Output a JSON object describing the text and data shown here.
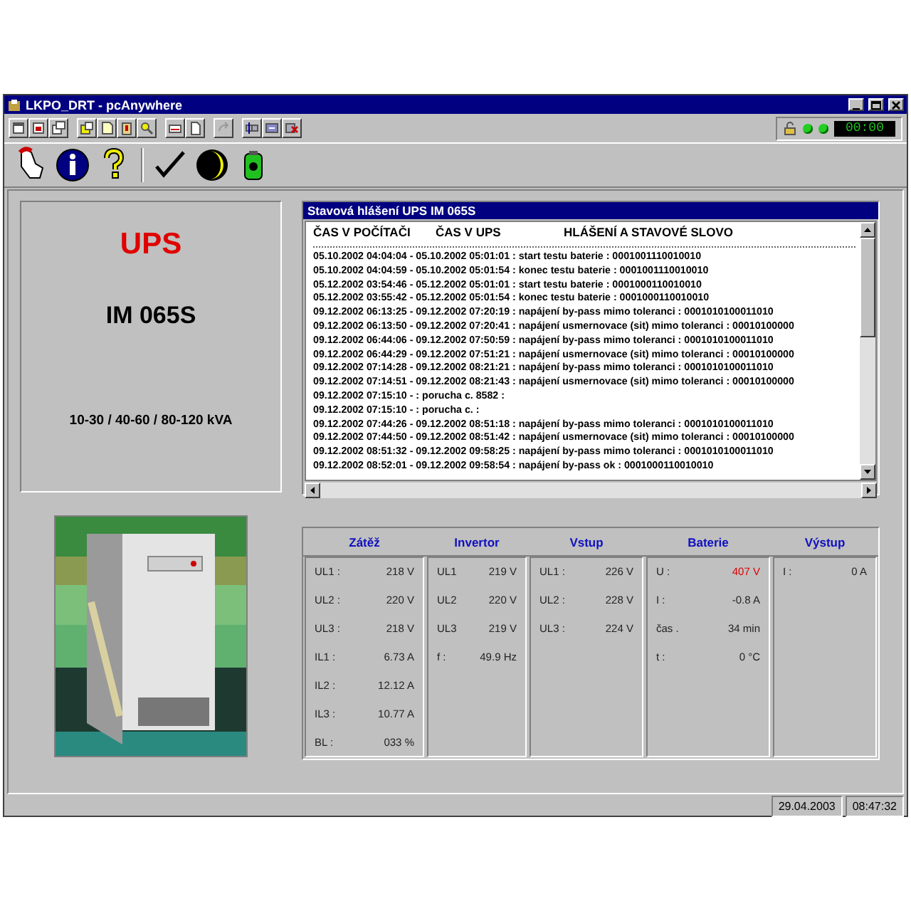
{
  "window": {
    "title": "LKPO_DRT - pcAnywhere"
  },
  "toolbar": {
    "status_leds": [
      {
        "on": true
      },
      {
        "on": true
      }
    ],
    "clock": "00:00"
  },
  "device": {
    "name": "UPS",
    "model": "IM 065S",
    "power_range": "10-30 / 40-60 / 80-120 kVA"
  },
  "log": {
    "title": "Stavová hlášení UPS IM 065S",
    "columns": [
      "ČAS V POČÍTAČI",
      "ČAS V UPS",
      "HLÁŠENÍ A STAVOVÉ SLOVO"
    ],
    "rows": [
      "05.10.2002 04:04:04 - 05.10.2002 05:01:01 : start testu baterie : 0001001110010010",
      "05.10.2002 04:04:59 - 05.10.2002 05:01:54 : konec testu baterie : 0001001110010010",
      "05.12.2002 03:54:46 - 05.12.2002 05:01:01 : start testu baterie : 0001000110010010",
      "05.12.2002 03:55:42 - 05.12.2002 05:01:54 : konec testu baterie : 0001000110010010",
      "09.12.2002 06:13:25 - 09.12.2002 07:20:19 : napájení by-pass mimo toleranci : 0001010100011010",
      "09.12.2002 06:13:50 - 09.12.2002 07:20:41 : napájení usmernovace (sit) mimo toleranci : 00010100000",
      "09.12.2002 06:44:06 - 09.12.2002 07:50:59 : napájení by-pass mimo toleranci : 0001010100011010",
      "09.12.2002 06:44:29 - 09.12.2002 07:51:21 : napájení usmernovace (sit) mimo toleranci : 00010100000",
      "09.12.2002 07:14:28 - 09.12.2002 08:21:21 : napájení by-pass mimo toleranci : 0001010100011010",
      "09.12.2002 07:14:51 - 09.12.2002 08:21:43 : napájení usmernovace (sit) mimo toleranci : 00010100000",
      "09.12.2002 07:15:10 -  : porucha c. 8582 :",
      "09.12.2002 07:15:10 -  : porucha c.  :",
      "09.12.2002 07:44:26 - 09.12.2002 08:51:18 : napájení by-pass mimo toleranci : 0001010100011010",
      "09.12.2002 07:44:50 - 09.12.2002 08:51:42 : napájení usmernovace (sit) mimo toleranci : 00010100000",
      "09.12.2002 08:51:32 - 09.12.2002 09:58:25 : napájení by-pass mimo toleranci : 0001010100011010",
      "09.12.2002 08:52:01 - 09.12.2002 09:58:54 : napájení by-pass ok : 0001000110010010"
    ]
  },
  "measurements": [
    {
      "title": "Zátěž",
      "readings": [
        {
          "label": "UL1 :",
          "value": "218 V",
          "alarm": false
        },
        {
          "label": "UL2 :",
          "value": "220 V",
          "alarm": false
        },
        {
          "label": "UL3 :",
          "value": "218 V",
          "alarm": false
        },
        {
          "label": "IL1 :",
          "value": "6.73 A",
          "alarm": false
        },
        {
          "label": "IL2 :",
          "value": "12.12 A",
          "alarm": false
        },
        {
          "label": "IL3 :",
          "value": "10.77 A",
          "alarm": false
        },
        {
          "label": "BL :",
          "value": "033 %",
          "alarm": false
        }
      ]
    },
    {
      "title": "Invertor",
      "readings": [
        {
          "label": "UL1",
          "value": "219 V",
          "alarm": false
        },
        {
          "label": "UL2",
          "value": "220 V",
          "alarm": false
        },
        {
          "label": "UL3",
          "value": "219 V",
          "alarm": false
        },
        {
          "label": "f :",
          "value": "49.9 Hz",
          "alarm": false
        }
      ]
    },
    {
      "title": "Vstup",
      "readings": [
        {
          "label": "UL1 :",
          "value": "226 V",
          "alarm": false
        },
        {
          "label": "UL2 :",
          "value": "228 V",
          "alarm": false
        },
        {
          "label": "UL3 :",
          "value": "224 V",
          "alarm": false
        }
      ]
    },
    {
      "title": "Baterie",
      "readings": [
        {
          "label": "U :",
          "value": "407 V",
          "alarm": true
        },
        {
          "label": "I :",
          "value": "-0.8 A",
          "alarm": false
        },
        {
          "label": "čas .",
          "value": "34 min",
          "alarm": false
        },
        {
          "label": "t :",
          "value": "0 °C",
          "alarm": false
        }
      ]
    },
    {
      "title": "Výstup",
      "readings": [
        {
          "label": "I :",
          "value": "0 A",
          "alarm": false
        }
      ]
    }
  ],
  "status_bar": [
    "29.04.2003",
    "08:47:32"
  ]
}
